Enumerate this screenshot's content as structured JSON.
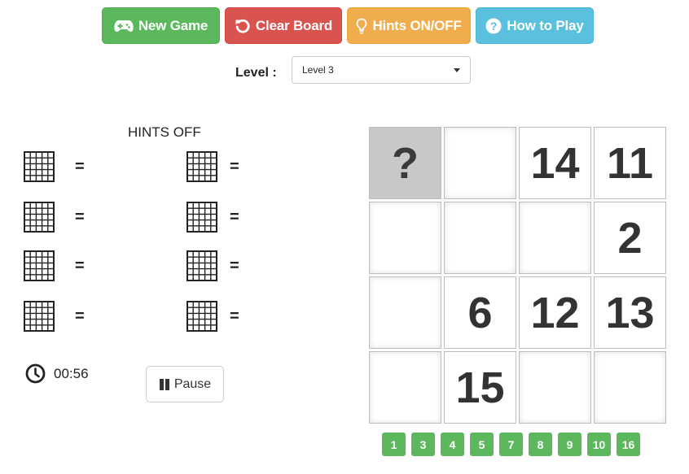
{
  "toolbar": {
    "new_game": "New Game",
    "clear_board": "Clear Board",
    "hints_toggle": "Hints ON/OFF",
    "how_to_play": "How to Play"
  },
  "level": {
    "label": "Level :",
    "selected": "Level 3"
  },
  "hints": {
    "status": "HINTS OFF",
    "equals": "="
  },
  "timer": {
    "time": "00:56"
  },
  "pause": {
    "label": "Pause"
  },
  "board": {
    "tiles": [
      "?",
      "",
      "14",
      "11",
      "",
      "",
      "",
      "2",
      "",
      "6",
      "12",
      "13",
      "",
      "15",
      "",
      ""
    ]
  },
  "available_numbers": [
    "1",
    "3",
    "4",
    "5",
    "7",
    "8",
    "9",
    "10",
    "16"
  ],
  "colors": {
    "green": "#5cb85c",
    "red": "#d9534f",
    "orange": "#f0ad4e",
    "blue": "#5bc0de"
  },
  "icons": {
    "new_game": "gamepad-icon",
    "clear_board": "undo-icon",
    "hints_toggle": "lightbulb-icon",
    "how_to_play": "question-circle-icon",
    "timer": "clock-icon",
    "pause": "pause-icon",
    "hint_cell": "grid-icon"
  }
}
